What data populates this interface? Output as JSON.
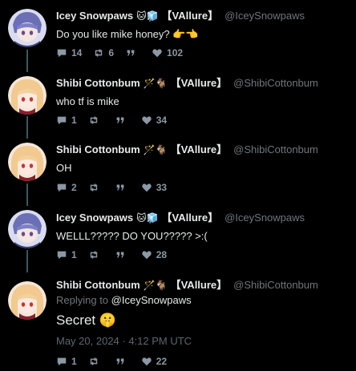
{
  "tweets": [
    {
      "name": "Icey Snowpaws",
      "emojis": "🐱🧊",
      "tag": "【VAllure】",
      "handle": "@IceySnowpaws",
      "text": "Do you like mike honey? 👉👈",
      "replies": "14",
      "retweets": "6",
      "quotes": "",
      "likes": "102"
    },
    {
      "name": "Shibi Cottonbum",
      "emojis": "🪄🐐",
      "tag": "【VAllure】",
      "handle": "@ShibiCottonbum",
      "text": "who tf is mike",
      "replies": "1",
      "retweets": "",
      "quotes": "",
      "likes": "34"
    },
    {
      "name": "Shibi Cottonbum",
      "emojis": "🪄🐐",
      "tag": "【VAllure】",
      "handle": "@ShibiCottonbum",
      "text": "OH",
      "replies": "2",
      "retweets": "",
      "quotes": "",
      "likes": "33"
    },
    {
      "name": "Icey Snowpaws",
      "emojis": "🐱🧊",
      "tag": "【VAllure】",
      "handle": "@IceySnowpaws",
      "text": "WELLL????? DO YOU????? >:(",
      "replies": "1",
      "retweets": "",
      "quotes": "",
      "likes": "28"
    },
    {
      "name": "Shibi Cottonbum",
      "emojis": "🪄🐐",
      "tag": "【VAllure】",
      "handle": "@ShibiCottonbum",
      "replying_prefix": "Replying to",
      "replying_to": "@IceySnowpaws",
      "text": "Secret 🤫",
      "timestamp": "May 20, 2024 · 4:12 PM UTC",
      "replies": "1",
      "retweets": "",
      "quotes": "",
      "likes": "22"
    }
  ],
  "colors": {
    "background": "#000000",
    "text": "#e7e9ea",
    "muted": "#6e767d",
    "thread_line": "#3a5a5e"
  }
}
